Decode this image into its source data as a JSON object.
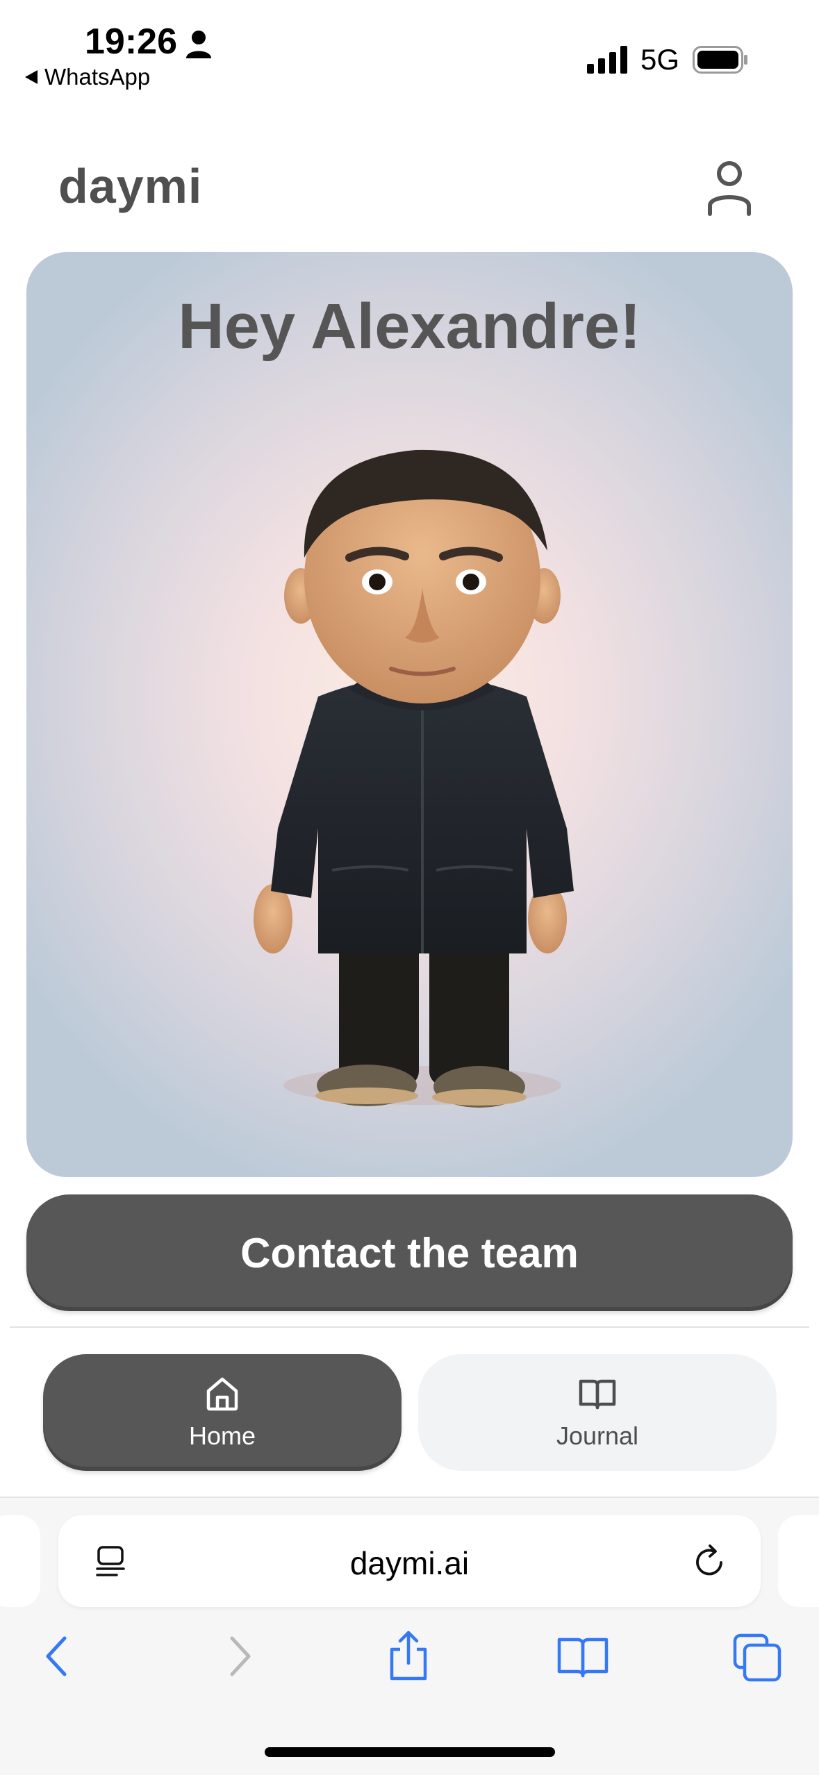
{
  "status_bar": {
    "time": "19:26",
    "back_app": "WhatsApp",
    "network": "5G"
  },
  "header": {
    "logo": "daymi",
    "profile_icon": "user-icon"
  },
  "hero": {
    "greeting": "Hey Alexandre!",
    "avatar": "3d-avatar-figure"
  },
  "actions": {
    "contact_label": "Contact the team"
  },
  "tabs": [
    {
      "label": "Home",
      "icon": "home-icon",
      "active": true
    },
    {
      "label": "Journal",
      "icon": "book-icon",
      "active": false
    }
  ],
  "browser": {
    "url": "daymi.ai",
    "accent_color": "#3478f6"
  },
  "colors": {
    "button_dark": "#575757",
    "tab_inactive": "#f2f3f5",
    "text": "#4f4f4f"
  }
}
